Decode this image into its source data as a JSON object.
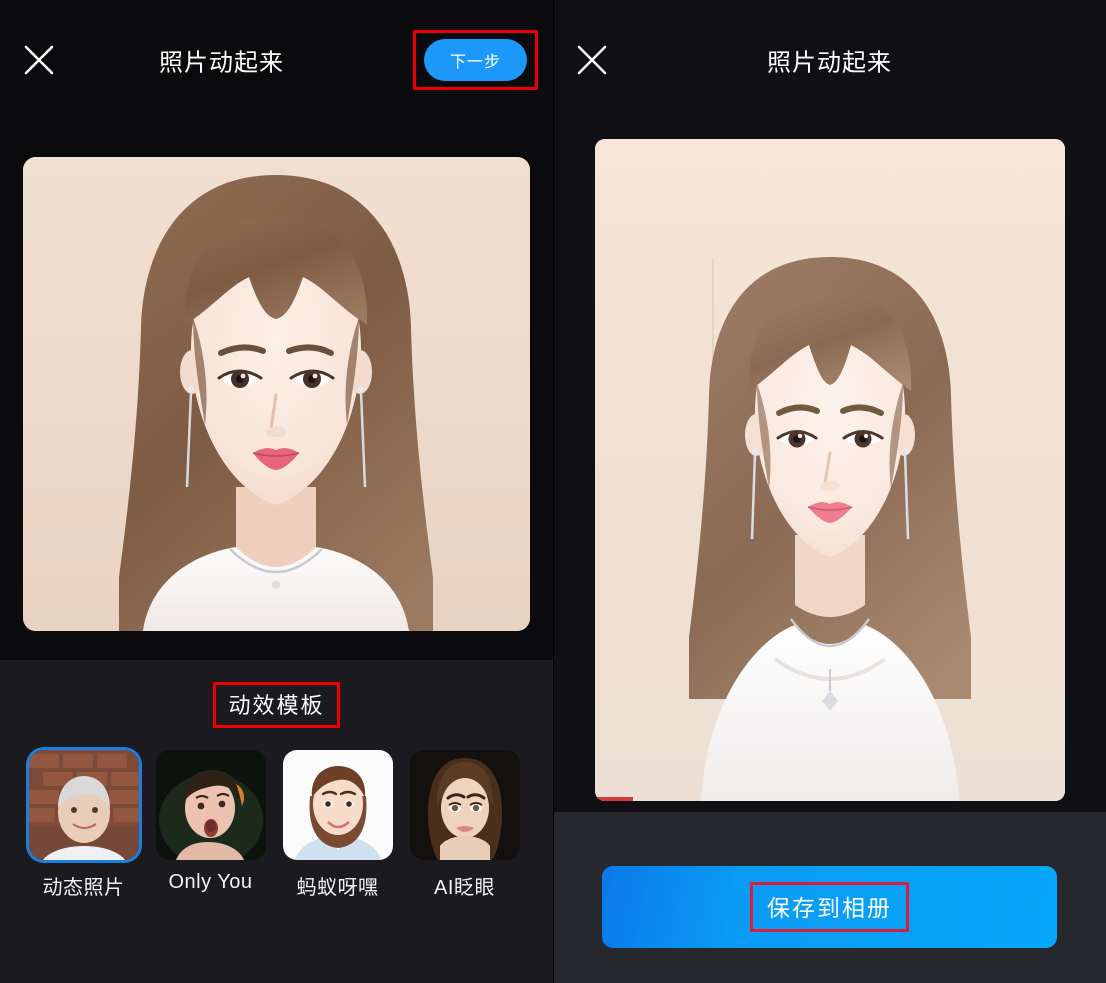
{
  "meta": {
    "accent_blue": "#1b98fa",
    "annotation_red": "#ee0000",
    "save_red": "#d8203c",
    "selected_border": "#1b7fe0",
    "panel_bg": "#0b0b0d",
    "templates_bg": "#1b1b1f",
    "save_bar_bg": "#27272e"
  },
  "left_panel": {
    "close_icon": "close-icon",
    "title": "照片动起来",
    "next_button": "下一步",
    "photo": {
      "alt": "young woman portrait, brown hair, beige background",
      "background_color": "#efdccd",
      "skin_color": "#f6e3d8",
      "hair_color": "#8e6b52",
      "lip_color": "#e8647a",
      "dress_color": "#f7f4f2"
    },
    "templates_section": {
      "heading": "动效模板",
      "items": [
        {
          "label": "动态照片",
          "selected": true,
          "thumb": "elderly-woman-brick-wall"
        },
        {
          "label": "Only You",
          "selected": false,
          "thumb": "surprised-girl-dark-bg"
        },
        {
          "label": "蚂蚁呀嘿",
          "selected": false,
          "thumb": "smiling-woman-white-bg"
        },
        {
          "label": "AI眨眼",
          "selected": false,
          "thumb": "brunette-woman-dark-bg"
        }
      ]
    }
  },
  "right_panel": {
    "close_icon": "close-icon",
    "title": "照片动起来",
    "photo": {
      "alt": "generated animated portrait result",
      "background_color": "#f2e4d6",
      "skin_color": "#f9ece4",
      "hair_color": "#9a7a62",
      "lip_color": "#ef7d92",
      "dress_color": "#fbfafa"
    },
    "progress_percent": 8,
    "save_button": "保存到相册"
  }
}
